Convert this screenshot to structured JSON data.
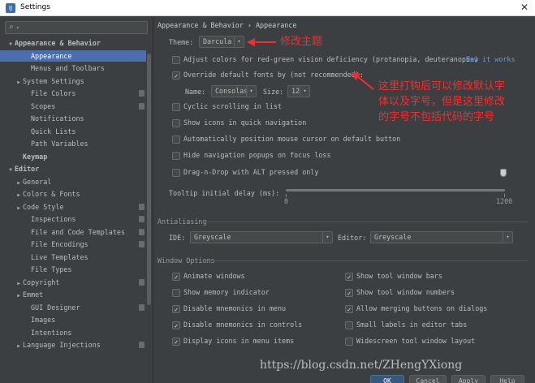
{
  "window": {
    "title": "Settings"
  },
  "sidebar": {
    "items": [
      {
        "label": "Appearance & Behavior",
        "bold": true,
        "indent": 0,
        "arrow": "down"
      },
      {
        "label": "Appearance",
        "indent": 2,
        "selected": true
      },
      {
        "label": "Menus and Toolbars",
        "indent": 2
      },
      {
        "label": "System Settings",
        "indent": 1,
        "arrow": "right"
      },
      {
        "label": "File Colors",
        "indent": 2,
        "project": true
      },
      {
        "label": "Scopes",
        "indent": 2,
        "project": true
      },
      {
        "label": "Notifications",
        "indent": 2
      },
      {
        "label": "Quick Lists",
        "indent": 2
      },
      {
        "label": "Path Variables",
        "indent": 2
      },
      {
        "label": "Keymap",
        "bold": true,
        "indent": 1
      },
      {
        "label": "Editor",
        "bold": true,
        "indent": 0,
        "arrow": "down"
      },
      {
        "label": "General",
        "indent": 1,
        "arrow": "right"
      },
      {
        "label": "Colors & Fonts",
        "indent": 1,
        "arrow": "right"
      },
      {
        "label": "Code Style",
        "indent": 1,
        "arrow": "right",
        "project": true
      },
      {
        "label": "Inspections",
        "indent": 2,
        "project": true
      },
      {
        "label": "File and Code Templates",
        "indent": 2,
        "project": true
      },
      {
        "label": "File Encodings",
        "indent": 2,
        "project": true
      },
      {
        "label": "Live Templates",
        "indent": 2
      },
      {
        "label": "File Types",
        "indent": 2
      },
      {
        "label": "Copyright",
        "indent": 1,
        "arrow": "right",
        "project": true
      },
      {
        "label": "Emmet",
        "indent": 1,
        "arrow": "right"
      },
      {
        "label": "GUI Designer",
        "indent": 2,
        "project": true
      },
      {
        "label": "Images",
        "indent": 2
      },
      {
        "label": "Intentions",
        "indent": 2
      },
      {
        "label": "Language Injections",
        "indent": 1,
        "arrow": "right",
        "project": true
      }
    ]
  },
  "content": {
    "breadcrumb": "Appearance & Behavior › Appearance",
    "theme_label": "Theme:",
    "theme_value": "Darcula",
    "adjust_colors": "Adjust colors for red-green vision deficiency (protanopia, deuteranopia)",
    "how_it_works": "How it works",
    "override_fonts": "Override default fonts by (not recommended):",
    "name_label": "Name:",
    "name_value": "Consolas",
    "size_label": "Size:",
    "size_value": "12",
    "cyclic_scrolling": "Cyclic scrolling in list",
    "show_icons_quick_nav": "Show icons in quick navigation",
    "auto_position_cursor": "Automatically position mouse cursor on default button",
    "hide_nav_popups": "Hide navigation popups on focus loss",
    "drag_n_drop": "Drag-n-Drop with ALT pressed only",
    "tooltip_label": "Tooltip initial delay (ms):",
    "tooltip_min": "0",
    "tooltip_max": "1200",
    "tooltip_value_fraction": 1.0,
    "antialiasing_title": "Antialiasing",
    "ide_label": "IDE:",
    "ide_value": "Greyscale",
    "editor_label": "Editor:",
    "editor_value": "Greyscale",
    "window_options_title": "Window Options",
    "opt_animate_windows": "Animate windows",
    "opt_show_memory": "Show memory indicator",
    "opt_disable_mnemonics_menu": "Disable mnemonics in menu",
    "opt_disable_mnemonics_controls": "Disable mnemonics in controls",
    "opt_display_icons_menu": "Display icons in menu items",
    "opt_show_tool_bars": "Show tool window bars",
    "opt_show_tool_numbers": "Show tool window numbers",
    "opt_allow_merging": "Allow merging buttons on dialogs",
    "opt_small_labels": "Small labels in editor tabs",
    "opt_widescreen": "Widescreen tool window layout",
    "checked": {
      "adjust_colors": false,
      "override_fonts": true,
      "cyclic": false,
      "show_icons": false,
      "auto_position": false,
      "hide_nav": false,
      "drag": false,
      "animate": true,
      "memory": false,
      "mn_menu": true,
      "mn_controls": true,
      "icons_menu": true,
      "tool_bars": true,
      "tool_numbers": true,
      "merging": true,
      "small_labels": false,
      "widescreen": false
    }
  },
  "buttons": {
    "ok": "OK",
    "cancel": "Cancel",
    "apply": "Apply",
    "help": "Help"
  },
  "annotations": {
    "theme_note": "修改主题",
    "font_note_1": "这里打钩后可以修改默认字",
    "font_note_2": "体以及字号，但是这里修改",
    "font_note_3": "的字号不包括代码的字号"
  },
  "watermark": "https://blog.csdn.net/ZHengYXiong",
  "colors": {
    "accent": "#4b6eaf",
    "link": "#589df6",
    "annotation": "#ff2a2a",
    "background": "#3c3f41"
  }
}
